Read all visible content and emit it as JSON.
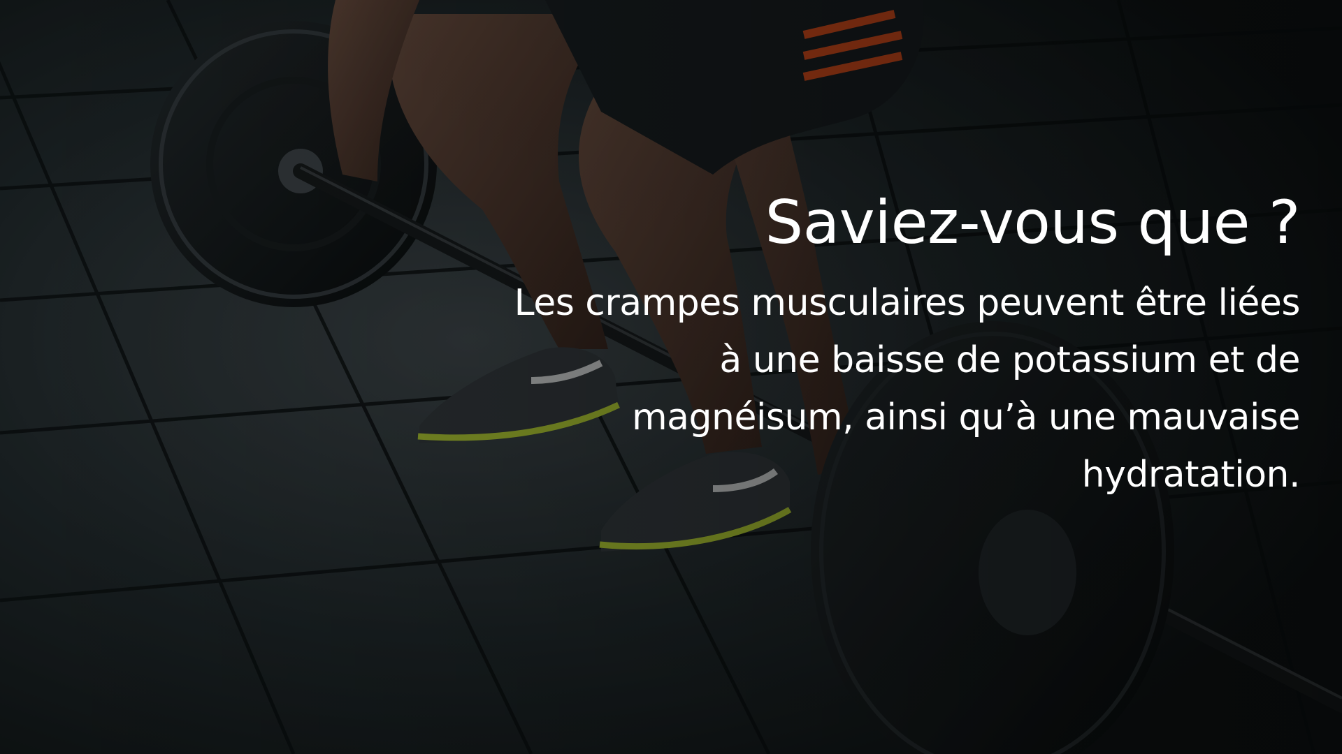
{
  "slide": {
    "title": "Saviez-vous que ?",
    "body": "Les crampes musculaires peuvent être liées à une baisse de potassium et de magnéisum, ainsi qu’à une mauvaise hydratation.",
    "text_color": "#ffffff",
    "overlay_color": "#000000"
  },
  "background_photo": {
    "subject": "athlete-lifting-barbell-on-gym-floor",
    "shoe_accent_color": "#c6e33a",
    "shorts_stripe_color": "#e8541f"
  }
}
